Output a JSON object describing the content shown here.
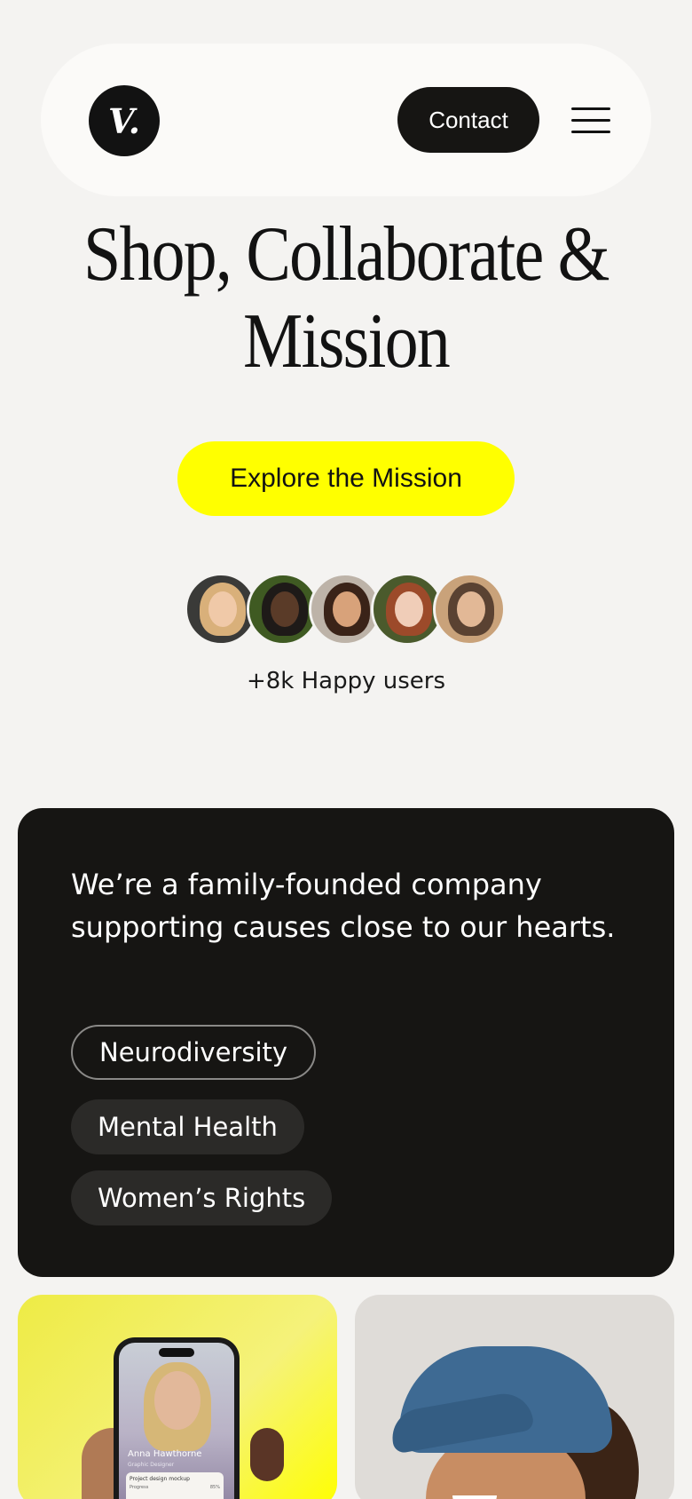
{
  "header": {
    "logo_text": "V.",
    "contact_label": "Contact",
    "menu_icon": "hamburger-menu-icon"
  },
  "hero": {
    "title_line1": "Shop, Collaborate &",
    "title_line2": "Mission",
    "cta_label": "Explore the Mission",
    "users_text": "+8k Happy users",
    "avatar_count": 5
  },
  "about": {
    "text": "We’re a family-founded company supporting causes close to our hearts.",
    "tags": [
      {
        "label": "Neurodiversity",
        "active": true
      },
      {
        "label": "Mental Health",
        "active": false
      },
      {
        "label": "Women’s Rights",
        "active": false
      }
    ]
  },
  "cards": {
    "phone": {
      "name": "Anna Hawthorne",
      "role": "Graphic Designer",
      "task_title": "Project design mockup",
      "progress_label": "Progress",
      "progress_value": "85%"
    }
  },
  "colors": {
    "accent": "#ffff00",
    "dark": "#161513",
    "background": "#f4f3f1"
  }
}
